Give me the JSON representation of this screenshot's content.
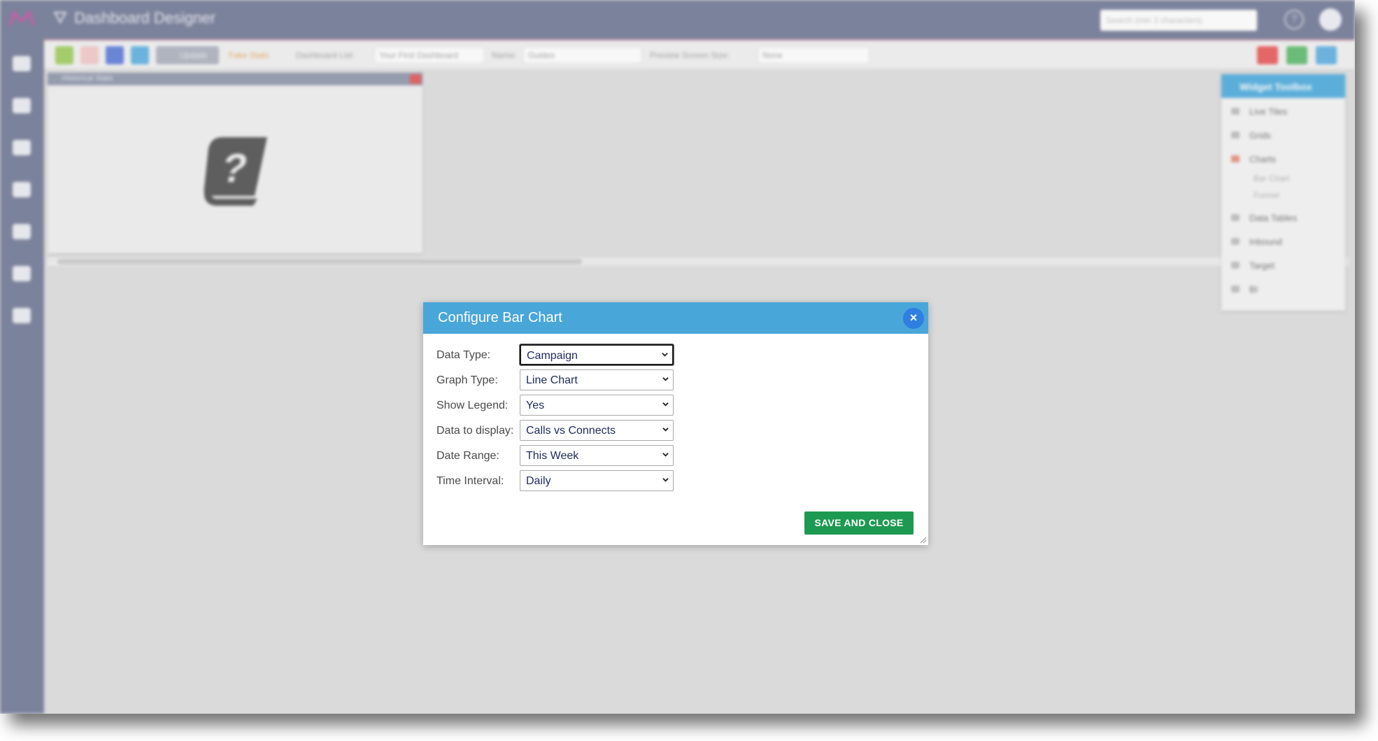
{
  "app": {
    "title": "Dashboard Designer",
    "search_placeholder": "Search (min 3 characters)"
  },
  "toolbar": {
    "update_label": "Update",
    "fake_stats_label": "Fake Stats",
    "dashboard_list_label": "Dashboard List:",
    "dashboard_list_value": "Your First Dashboard",
    "name_label": "Name:",
    "name_value": "Guides",
    "preview_size_label": "Preview Screen Size:",
    "preview_size_value": "None"
  },
  "widget": {
    "title": "Historical Stats"
  },
  "widget_toolbox": {
    "title": "Widget Toolbox",
    "items": [
      "Live Tiles",
      "Grids",
      "Charts",
      "Data Tables",
      "Inbound",
      "Target",
      "BI"
    ],
    "chart_subitems": [
      "Bar Chart",
      "Funnel"
    ]
  },
  "modal": {
    "title": "Configure Bar Chart",
    "close_glyph": "×",
    "fields": [
      {
        "label": "Data Type:",
        "value": "Campaign"
      },
      {
        "label": "Graph Type:",
        "value": "Line Chart"
      },
      {
        "label": "Show Legend:",
        "value": "Yes"
      },
      {
        "label": "Data to display:",
        "value": "Calls vs Connects"
      },
      {
        "label": "Date Range:",
        "value": "This Week"
      },
      {
        "label": "Time Interval:",
        "value": "Daily"
      }
    ],
    "save_label": "SAVE AND CLOSE"
  },
  "colors": {
    "header_blue": "#49a6d9",
    "save_green": "#1e9952",
    "close_blue": "#2f7fe0",
    "nav_slate": "#6d7592"
  }
}
